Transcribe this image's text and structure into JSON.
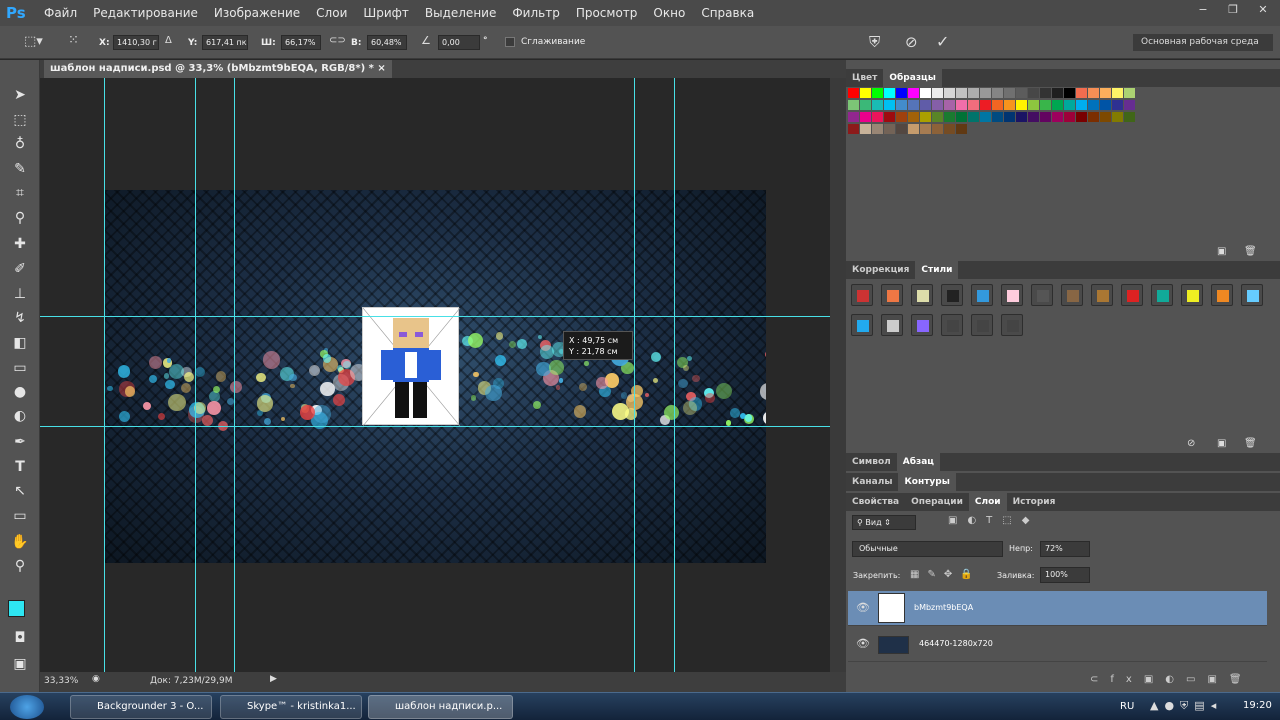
{
  "app": {
    "logo": "Ps"
  },
  "menu": [
    "Файл",
    "Редактирование",
    "Изображение",
    "Слои",
    "Шрифт",
    "Выделение",
    "Фильтр",
    "Просмотр",
    "Окно",
    "Справка"
  ],
  "window_controls": {
    "minimize": "−",
    "restore": "❐",
    "close": "✕"
  },
  "options": {
    "x_label": "X:",
    "x_value": "1410,30 г",
    "y_label": "Y:",
    "y_value": "617,41 пк",
    "w_label": "Ш:",
    "w_value": "66,17%",
    "h_label": "В:",
    "h_value": "60,48%",
    "angle_value": "0,00",
    "angle_unit": "°",
    "antialias_label": "Сглаживание",
    "workspace": "Основная рабочая среда"
  },
  "document": {
    "tab_title": "шаблон надписи.psd @ 33,3% (bMbzmt9bEQA, RGB/8*) *",
    "readout_x": "X :  49,75 см",
    "readout_y": "Y :  21,78 см",
    "zoom": "33,33%",
    "doc_size": "Док: 7,23M/29,9M"
  },
  "panels": {
    "color_tabs": [
      "Цвет",
      "Образцы"
    ],
    "correction_tabs": [
      "Коррекция",
      "Стили"
    ],
    "char_tabs": [
      "Символ",
      "Абзац"
    ],
    "channel_tabs": [
      "Каналы",
      "Контуры"
    ],
    "layer_tabs": [
      "Свойства",
      "Операции",
      "Слои",
      "История"
    ],
    "filter_kind": "Вид",
    "blend_mode": "Обычные",
    "opacity_label": "Непр:",
    "opacity_value": "72%",
    "lock_label": "Закрепить:",
    "fill_label": "Заливка:",
    "fill_value": "100%",
    "layers": [
      {
        "name": "bMbzmt9bEQA",
        "selected": true
      },
      {
        "name": "464470-1280x720",
        "selected": false
      }
    ]
  },
  "taskbar": {
    "items": [
      "Backgrounder 3 - O...",
      "Skype™ - kristinka1...",
      "шаблон надписи.p..."
    ],
    "lang": "RU",
    "time": "19:20"
  },
  "colors": {
    "foreground": "#2ee6f2",
    "background": "#ffffff",
    "guide": "#48e0e6",
    "accent_layer": "#6b8db5"
  }
}
